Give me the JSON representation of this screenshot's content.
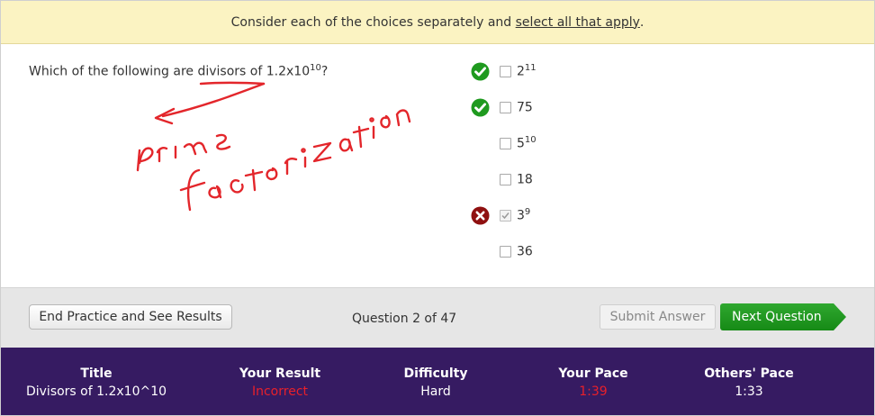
{
  "instruction": {
    "before": "Consider each of the choices separately and",
    "link": "select all that apply",
    "after": "."
  },
  "question": {
    "text": "Which of the following are divisors of 1.2x10",
    "exponent": "10",
    "suffix": "?"
  },
  "choices": [
    {
      "base": "2",
      "exp": "11",
      "checked": false,
      "mark": "correct-check"
    },
    {
      "base": "75",
      "exp": "",
      "checked": false,
      "mark": "correct-check"
    },
    {
      "base": "5",
      "exp": "10",
      "checked": false,
      "mark": ""
    },
    {
      "base": "18",
      "exp": "",
      "checked": false,
      "mark": ""
    },
    {
      "base": "3",
      "exp": "9",
      "checked": true,
      "mark": "incorrect-x"
    },
    {
      "base": "36",
      "exp": "",
      "checked": false,
      "mark": ""
    }
  ],
  "annotation": {
    "handwriting": [
      "prime",
      "factorization"
    ],
    "color": "#e3262b"
  },
  "toolbar": {
    "end_label": "End Practice and See Results",
    "counter": "Question 2 of 47",
    "submit_label": "Submit Answer",
    "next_label": "Next Question"
  },
  "stats": {
    "title": {
      "label": "Title",
      "value": "Divisors of 1.2x10^10"
    },
    "result": {
      "label": "Your Result",
      "value": "Incorrect"
    },
    "difficulty": {
      "label": "Difficulty",
      "value": "Hard"
    },
    "pace": {
      "label": "Your Pace",
      "value": "1:39"
    },
    "others": {
      "label": "Others' Pace",
      "value": "1:33"
    }
  },
  "colors": {
    "banner": "#fbf3c2",
    "stats_bar": "#361b62",
    "next_button": "#1e961e",
    "correct": "#1f9a1f",
    "incorrect": "#8f1010",
    "bad_text": "#e8202a"
  }
}
